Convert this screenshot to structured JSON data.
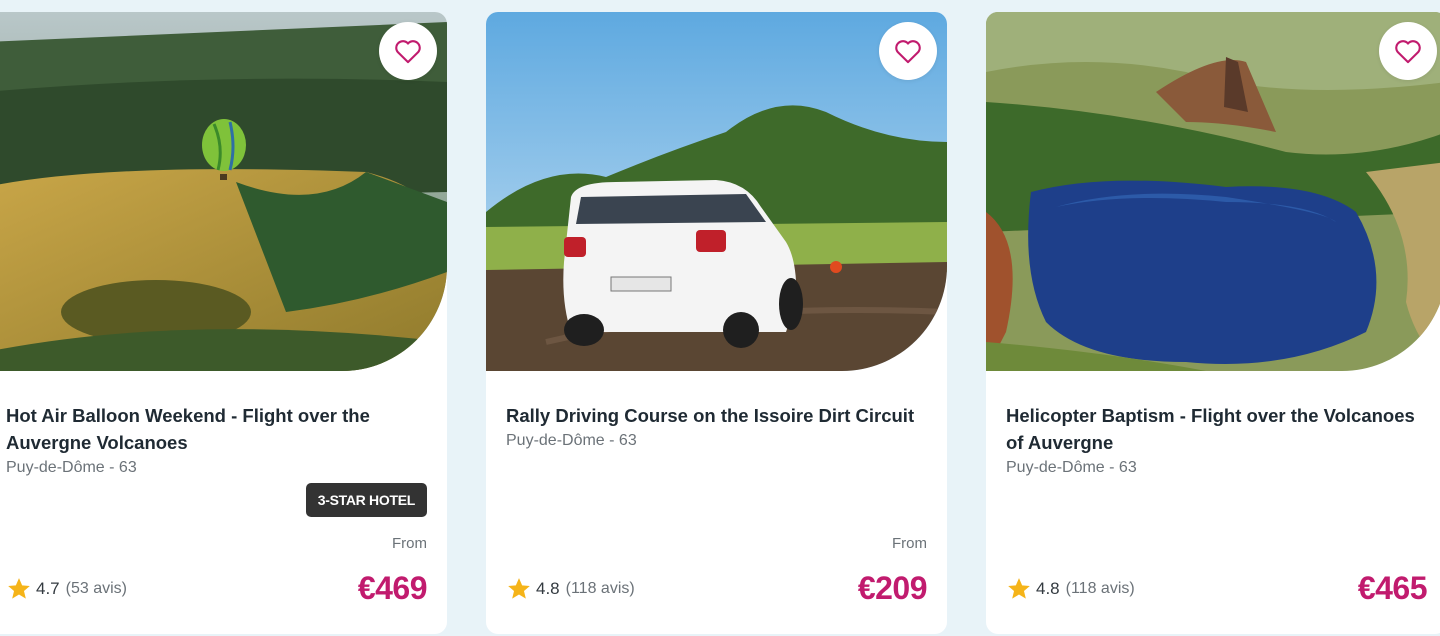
{
  "colors": {
    "price": "#c11b6e",
    "star": "#f5b419",
    "heart": "#c11b6e",
    "badge_bg": "#333333"
  },
  "cards": [
    {
      "title": "Hot Air Balloon Weekend - Flight over the Auvergne Volcanoes",
      "location": "Puy-de-Dôme - 63",
      "badge": "3-STAR HOTEL",
      "from_label": "From",
      "rating": "4.7",
      "reviews": "(53 avis)",
      "price": "€469",
      "favorite_icon": "heart-icon",
      "image": "hot-air-balloon-over-volcano-crater"
    },
    {
      "title": "Rally Driving Course on the Issoire Dirt Circuit",
      "location": "Puy-de-Dôme - 63",
      "from_label": "From",
      "rating": "4.8",
      "reviews": "(118 avis)",
      "price": "€209",
      "favorite_icon": "heart-icon",
      "image": "white-rally-car-on-dirt-track"
    },
    {
      "title": "Helicopter Baptism - Flight over the Volcanoes of Auvergne",
      "location": "Puy-de-Dôme - 63",
      "rating": "4.8",
      "reviews": "(118 avis)",
      "price": "€465",
      "favorite_icon": "heart-icon",
      "image": "aerial-view-of-volcanic-lake"
    }
  ]
}
